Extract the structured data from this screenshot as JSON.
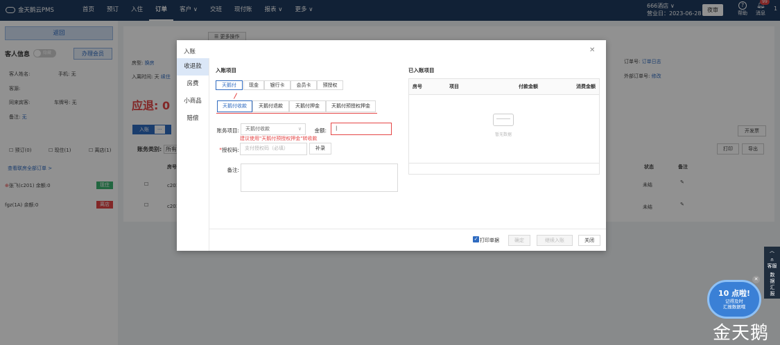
{
  "brand": "金天鹅云PMS",
  "nav": [
    "首页",
    "预订",
    "入住",
    "订单",
    "客户",
    "交班",
    "现付账",
    "报表",
    "更多"
  ],
  "nav_active": 3,
  "hotel": {
    "name": "666酒店",
    "date": "营业日：2023-06-28"
  },
  "night_audit": "夜审",
  "help": "帮助",
  "messages": "消息",
  "msg_badge": "99",
  "edge_num": "1",
  "left": {
    "back": "返回",
    "guest_info": "客人信息",
    "toggle": "隐藏",
    "member": "办理会员",
    "guest_name": "客人姓名:",
    "phone": "手机: 无",
    "source": "客源:",
    "companion": "同来宾客:",
    "plate": "车牌号: 无",
    "remark": "备注:",
    "remark_val": "无",
    "check_reserve": "预订(0)",
    "check_in": "现住(1)",
    "check_out": "离店(1)",
    "view_all": "查看联房全部订单 >",
    "rows": [
      {
        "name": "张飞(c201)",
        "balance": "余额:0",
        "tag": "现住",
        "color": "#3cb371"
      },
      {
        "name": "fgz(1A)",
        "balance": "余额:0",
        "tag": "离店",
        "color": "#e54545"
      }
    ]
  },
  "main": {
    "more_ops": "更多操作",
    "room_type": "房型:",
    "room_type_val": "换房",
    "checkin_time": "入离时间: 天",
    "renew": "续住",
    "order_no": "订单号:",
    "order_log": "订单日志",
    "ext_order": "外部订单号:",
    "modify": "修改",
    "refund": "应退: 0",
    "tab_in": "入账",
    "tab_more": "···",
    "category": "账务类别:",
    "category_val": "所有",
    "invoice": "开发票",
    "print": "打印",
    "export": "导出",
    "col_room": "房号",
    "col_status": "状态",
    "col_remark": "备注",
    "rows": [
      {
        "room": "c201",
        "status": "未结"
      },
      {
        "room": "c201",
        "status": "未结"
      }
    ]
  },
  "modal": {
    "title": "入账",
    "side": [
      "收退款",
      "房费",
      "小商品",
      "赔偿"
    ],
    "side_active": 0,
    "section_left": "入账项目",
    "section_right": "已入账项目",
    "pay_tabs": [
      "天鹅付",
      "现金",
      "银行卡",
      "会员卡",
      "预授权"
    ],
    "pay_active": 0,
    "sub_tabs": [
      "天鹅付收款",
      "天鹅付退款",
      "天鹅付押金",
      "天鹅付预授权押金"
    ],
    "sub_active": 0,
    "item_label": "账务项目:",
    "item_value": "天鹅付收款",
    "amount_label": "金额:",
    "amount_value": "|",
    "hint": "建议使用\"天鹅付预授权押金\"转收款",
    "auth_label": "授权码:",
    "auth_placeholder": "支付授权码（必填）",
    "retry": "补录",
    "remark_label": "备注:",
    "table_cols": [
      "房号",
      "项目",
      "付款金额",
      "消费金额"
    ],
    "empty": "暂无数据",
    "print_receipt": "打印单据",
    "confirm": "确定",
    "continue": "继续入账",
    "close": "关闭"
  },
  "float": {
    "service": "客服",
    "data": "数据汇报",
    "bubble_title": "10 点啦!",
    "bubble_l1": "记得及时",
    "bubble_l2": "汇报数据哦"
  },
  "watermark": "金天鹅"
}
